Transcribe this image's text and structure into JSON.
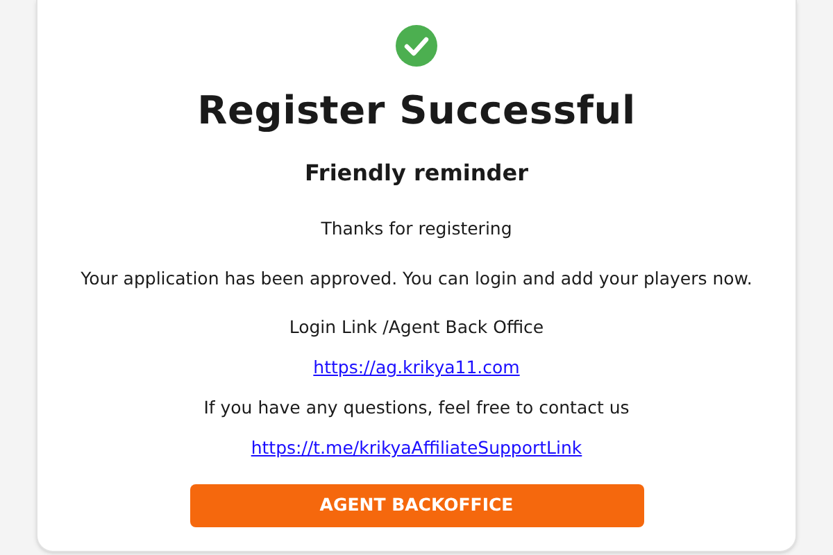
{
  "title": "Register Successful",
  "subtitle": "Friendly reminder",
  "lines": [
    {
      "kind": "text",
      "text": "Thanks for registering"
    },
    {
      "kind": "text",
      "text": "Your application has been approved. You can login and add your players now."
    },
    {
      "kind": "text",
      "text": "Login Link /Agent Back Office"
    },
    {
      "kind": "link",
      "text": "https://ag.krikya11.com"
    },
    {
      "kind": "text",
      "text": "If you have any questions, feel free to contact us"
    },
    {
      "kind": "link",
      "text": "https://t.me/krikyaAffiliateSupportLink"
    }
  ],
  "button": "AGENT BACKOFFICE"
}
